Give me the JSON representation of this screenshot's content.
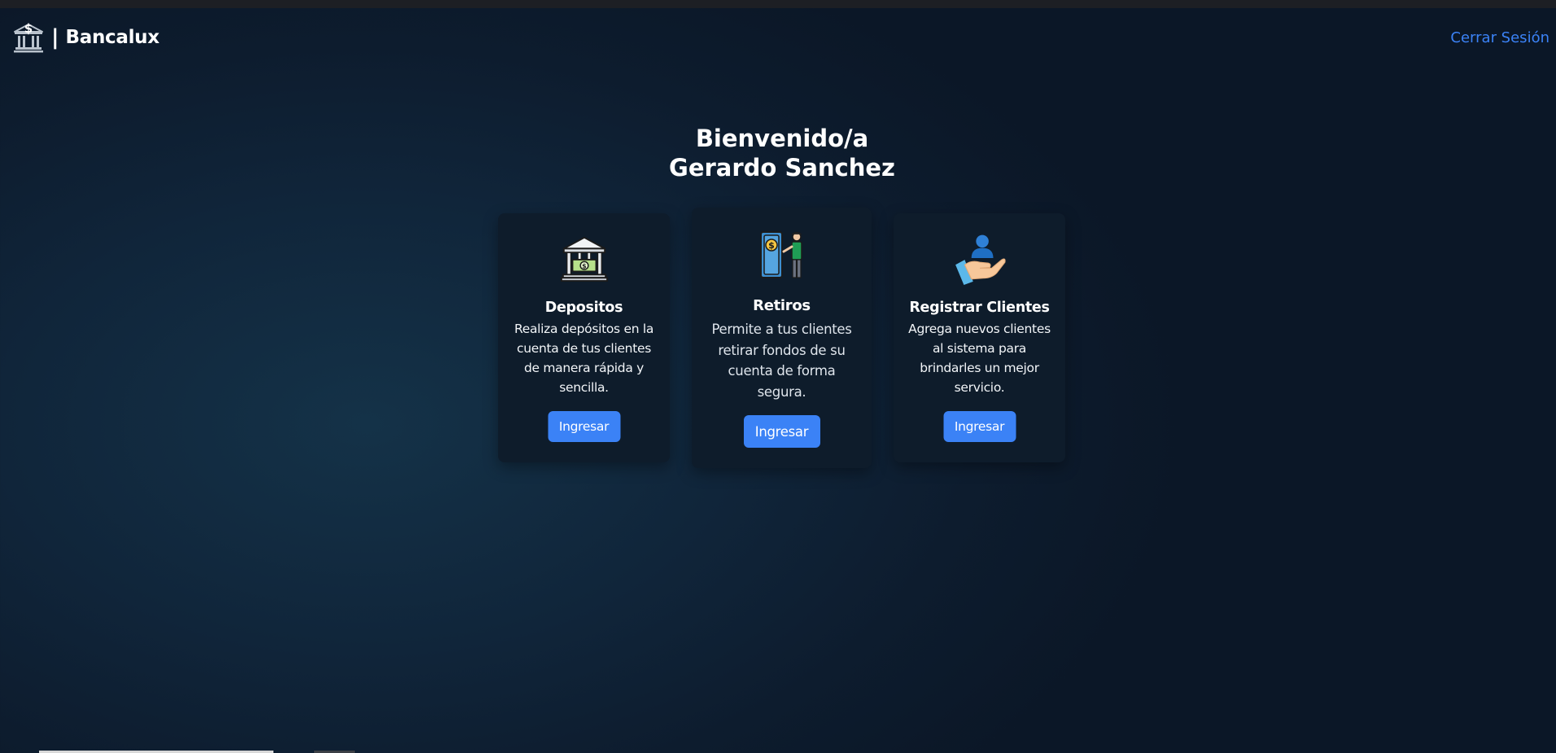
{
  "brand": {
    "separator": "|",
    "name": "Bancalux",
    "logo_icon": "bank-dollar-icon"
  },
  "nav": {
    "logout_label": "Cerrar Sesión"
  },
  "welcome": {
    "line1": "Bienvenido/a",
    "line2": "Gerardo Sanchez"
  },
  "cards": [
    {
      "icon": "bank-deposit-icon",
      "title": "Depositos",
      "lines": [
        "Realiza depósitos en la",
        "cuenta de tus clientes",
        "de manera rápida y",
        "sencilla."
      ],
      "button_label": "Ingresar"
    },
    {
      "icon": "atm-withdrawal-icon",
      "title": "Retiros",
      "lines": [
        "Permite a tus clientes",
        "retirar fondos de su",
        "cuenta de forma",
        "segura."
      ],
      "button_label": "Ingresar"
    },
    {
      "icon": "hand-user-icon",
      "title": "Registrar Clientes",
      "lines": [
        "Agrega nuevos clientes",
        "al sistema para",
        "brindarles un mejor",
        "servicio."
      ],
      "button_label": "Ingresar"
    }
  ],
  "colors": {
    "accent": "#3b82f6",
    "card_background": "#0e1c2b",
    "page_background": "#0d1c2e"
  }
}
